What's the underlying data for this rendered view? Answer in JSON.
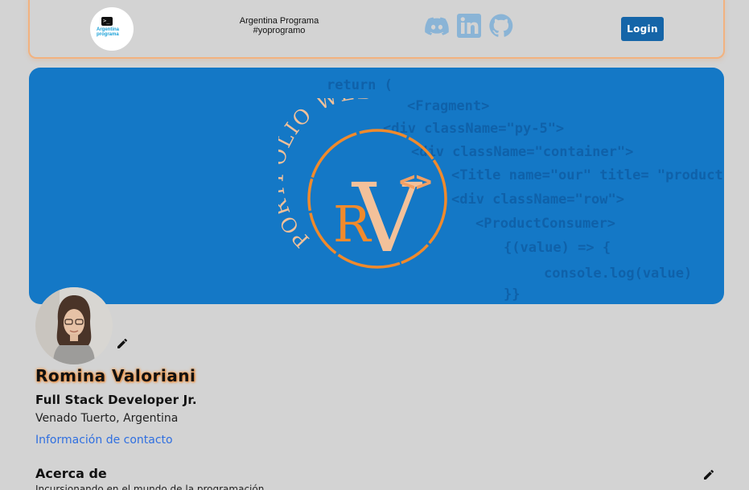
{
  "navbar": {
    "logo_text": "Argentina programa",
    "brand_line1": "Argentina Programa",
    "brand_line2": "#yoprogramo",
    "social": [
      "discord-icon",
      "linkedin-icon",
      "github-icon"
    ],
    "social_color": "#8ab4d6",
    "login_label": "Login"
  },
  "banner": {
    "code_lines": [
      "return (",
      "<Fragment>",
      "<div className=\"py-5\">",
      "<div className=\"container\">",
      "<Title name=\"our\" title= \"products\"",
      "<div className=\"row\">",
      "<ProductConsumer>",
      "{(value) => {",
      "console.log(value)",
      "}}"
    ],
    "emblem_arc_text": "PORTFOLIO WEB",
    "emblem_letter_r": "R",
    "emblem_letter_v": "V",
    "emblem_code_mark": "<>",
    "bg_color": "#1478c6",
    "accent": "#f08a2c"
  },
  "profile": {
    "name": "Romina Valoriani",
    "role": "Full Stack Developer Jr.",
    "location": "Venado Tuerto, Argentina",
    "contact_link": "Información de contacto"
  },
  "about": {
    "title": "Acerca de",
    "text": "Incursionando en el mundo de la programación"
  }
}
